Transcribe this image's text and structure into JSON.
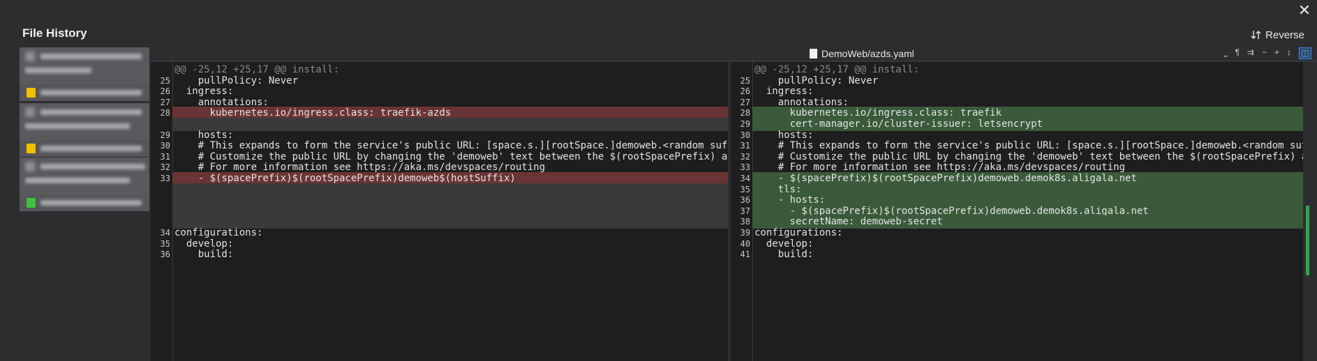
{
  "window": {
    "close_glyph": "✕",
    "title": "File History",
    "reverse_label": "Reverse"
  },
  "file": {
    "path": "DemoWeb/azds.yaml"
  },
  "colors": {
    "removed": "#6b3434",
    "added": "#3a5a3a",
    "blank": "#3a3a3c"
  },
  "left": {
    "lines": [
      {
        "ln": "",
        "text": "@@ -25,12 +25,17 @@ install:",
        "kind": "hunk"
      },
      {
        "ln": "25",
        "text": "    pullPolicy: Never",
        "kind": "ctx"
      },
      {
        "ln": "26",
        "text": "  ingress:",
        "kind": "ctx"
      },
      {
        "ln": "27",
        "text": "    annotations:",
        "kind": "ctx"
      },
      {
        "ln": "28",
        "text": "      kubernetes.io/ingress.class: traefik-azds",
        "kind": "del"
      },
      {
        "ln": "",
        "text": "",
        "kind": "blank"
      },
      {
        "ln": "29",
        "text": "    hosts:",
        "kind": "ctx"
      },
      {
        "ln": "30",
        "text": "    # This expands to form the service's public URL: [space.s.][rootSpace.]demoweb.<random suffix>.<region>.azds.io",
        "kind": "ctx"
      },
      {
        "ln": "31",
        "text": "    # Customize the public URL by changing the 'demoweb' text between the $(rootSpacePrefix) and $(hostSuffix) tokens",
        "kind": "ctx"
      },
      {
        "ln": "32",
        "text": "    # For more information see https://aka.ms/devspaces/routing",
        "kind": "ctx"
      },
      {
        "ln": "33",
        "text": "    - $(spacePrefix)$(rootSpacePrefix)demoweb$(hostSuffix)",
        "kind": "del"
      },
      {
        "ln": "",
        "text": "",
        "kind": "blank"
      },
      {
        "ln": "",
        "text": "",
        "kind": "blank"
      },
      {
        "ln": "",
        "text": "",
        "kind": "blank"
      },
      {
        "ln": "",
        "text": "",
        "kind": "blank"
      },
      {
        "ln": "34",
        "text": "configurations:",
        "kind": "ctx"
      },
      {
        "ln": "35",
        "text": "  develop:",
        "kind": "ctx"
      },
      {
        "ln": "36",
        "text": "    build:",
        "kind": "ctx"
      }
    ]
  },
  "right": {
    "lines": [
      {
        "ln": "",
        "text": "@@ -25,12 +25,17 @@ install:",
        "kind": "hunk"
      },
      {
        "ln": "25",
        "text": "    pullPolicy: Never",
        "kind": "ctx"
      },
      {
        "ln": "26",
        "text": "  ingress:",
        "kind": "ctx"
      },
      {
        "ln": "27",
        "text": "    annotations:",
        "kind": "ctx"
      },
      {
        "ln": "28",
        "text": "      kubernetes.io/ingress.class: traefik",
        "kind": "add"
      },
      {
        "ln": "29",
        "text": "      cert-manager.io/cluster-issuer: letsencrypt",
        "kind": "add"
      },
      {
        "ln": "30",
        "text": "    hosts:",
        "kind": "ctx"
      },
      {
        "ln": "31",
        "text": "    # This expands to form the service's public URL: [space.s.][rootSpace.]demoweb.<random suffix>.<region>.azds.io",
        "kind": "ctx"
      },
      {
        "ln": "32",
        "text": "    # Customize the public URL by changing the 'demoweb' text between the $(rootSpacePrefix) and $(hostSuffix) tokens",
        "kind": "ctx"
      },
      {
        "ln": "33",
        "text": "    # For more information see https://aka.ms/devspaces/routing",
        "kind": "ctx"
      },
      {
        "ln": "34",
        "text": "    - $(spacePrefix)$(rootSpacePrefix)demoweb.demok8s.aligala.net",
        "kind": "add"
      },
      {
        "ln": "35",
        "text": "    tls:",
        "kind": "add"
      },
      {
        "ln": "36",
        "text": "    - hosts:",
        "kind": "add"
      },
      {
        "ln": "37",
        "text": "      - $(spacePrefix)$(rootSpacePrefix)demoweb.demok8s.aligala.net",
        "kind": "add"
      },
      {
        "ln": "38",
        "text": "      secretName: demoweb-secret",
        "kind": "add"
      },
      {
        "ln": "39",
        "text": "configurations:",
        "kind": "ctx"
      },
      {
        "ln": "40",
        "text": "  develop:",
        "kind": "ctx"
      },
      {
        "ln": "41",
        "text": "    build:",
        "kind": "ctx"
      }
    ]
  },
  "toolbar": {
    "icons": [
      "whitespace-icon",
      "pilcrow-icon",
      "wrap-icon",
      "collapse-icon",
      "expand-icon",
      "sync-scroll-icon",
      "side-by-side-icon"
    ],
    "glyphs": [
      "⎵",
      "¶",
      "⇉",
      "−",
      "+",
      "↕",
      "◫"
    ]
  }
}
